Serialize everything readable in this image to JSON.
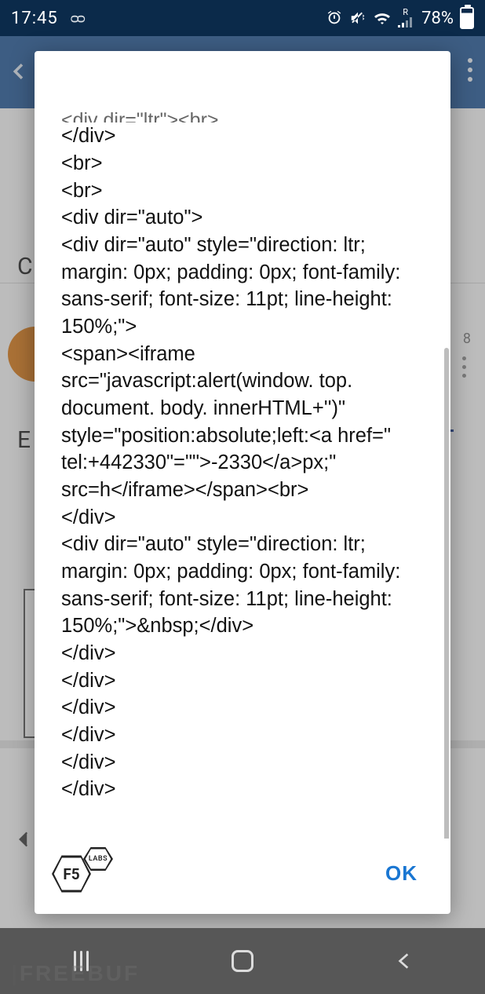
{
  "status": {
    "time": "17:45",
    "voicemail_glyph": "ᴑᴑ",
    "battery_pct": "78%"
  },
  "background": {
    "letter_c": "C",
    "letter_e": "E",
    "row_number": "8"
  },
  "dialog": {
    "cut_line": "<div dir=\"ltr\"><br>",
    "lines": [
      "</div>",
      "<br>",
      "<br>",
      "<div dir=\"auto\">",
      "<div dir=\"auto\" style=\"direction: ltr; margin: 0px; padding: 0px; font-family: sans-serif; font-size: 11pt; line-height: 150%;\">",
      "<span><iframe src=\"javascript:alert(window. top. document. body. innerHTML+'')\" style=\"position:absolute;left:<a href=\" tel:+442330\"=\"\">-2330</a>px;\" src=h</iframe></span><br>",
      "</div>",
      "<div dir=\"auto\" style=\"direction: ltr; margin: 0px; padding: 0px; font-family: sans-serif; font-size: 11pt; line-height: 150%;\">&nbsp;</div>",
      "</div>",
      "</div>",
      "</div>",
      "</div>",
      "</div>",
      "</div>"
    ],
    "ok": "OK",
    "logo_big": "F5",
    "logo_small": "LABS"
  },
  "watermark": "FREEBUF"
}
